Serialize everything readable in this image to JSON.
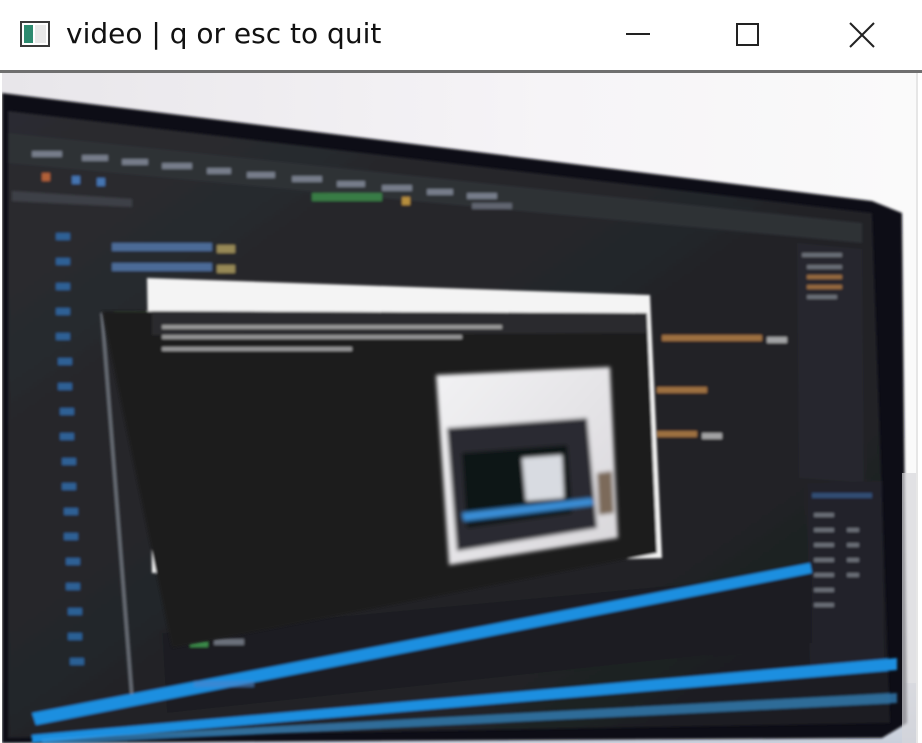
{
  "window": {
    "title": "video | q or esc to quit",
    "icon": "window-app-icon",
    "controls": {
      "minimize": "minimize-icon",
      "maximize": "maximize-icon",
      "close": "close-icon"
    }
  },
  "content": {
    "type": "live-camera-feed",
    "subject": "photo-of-monitor-showing-code-editor"
  }
}
